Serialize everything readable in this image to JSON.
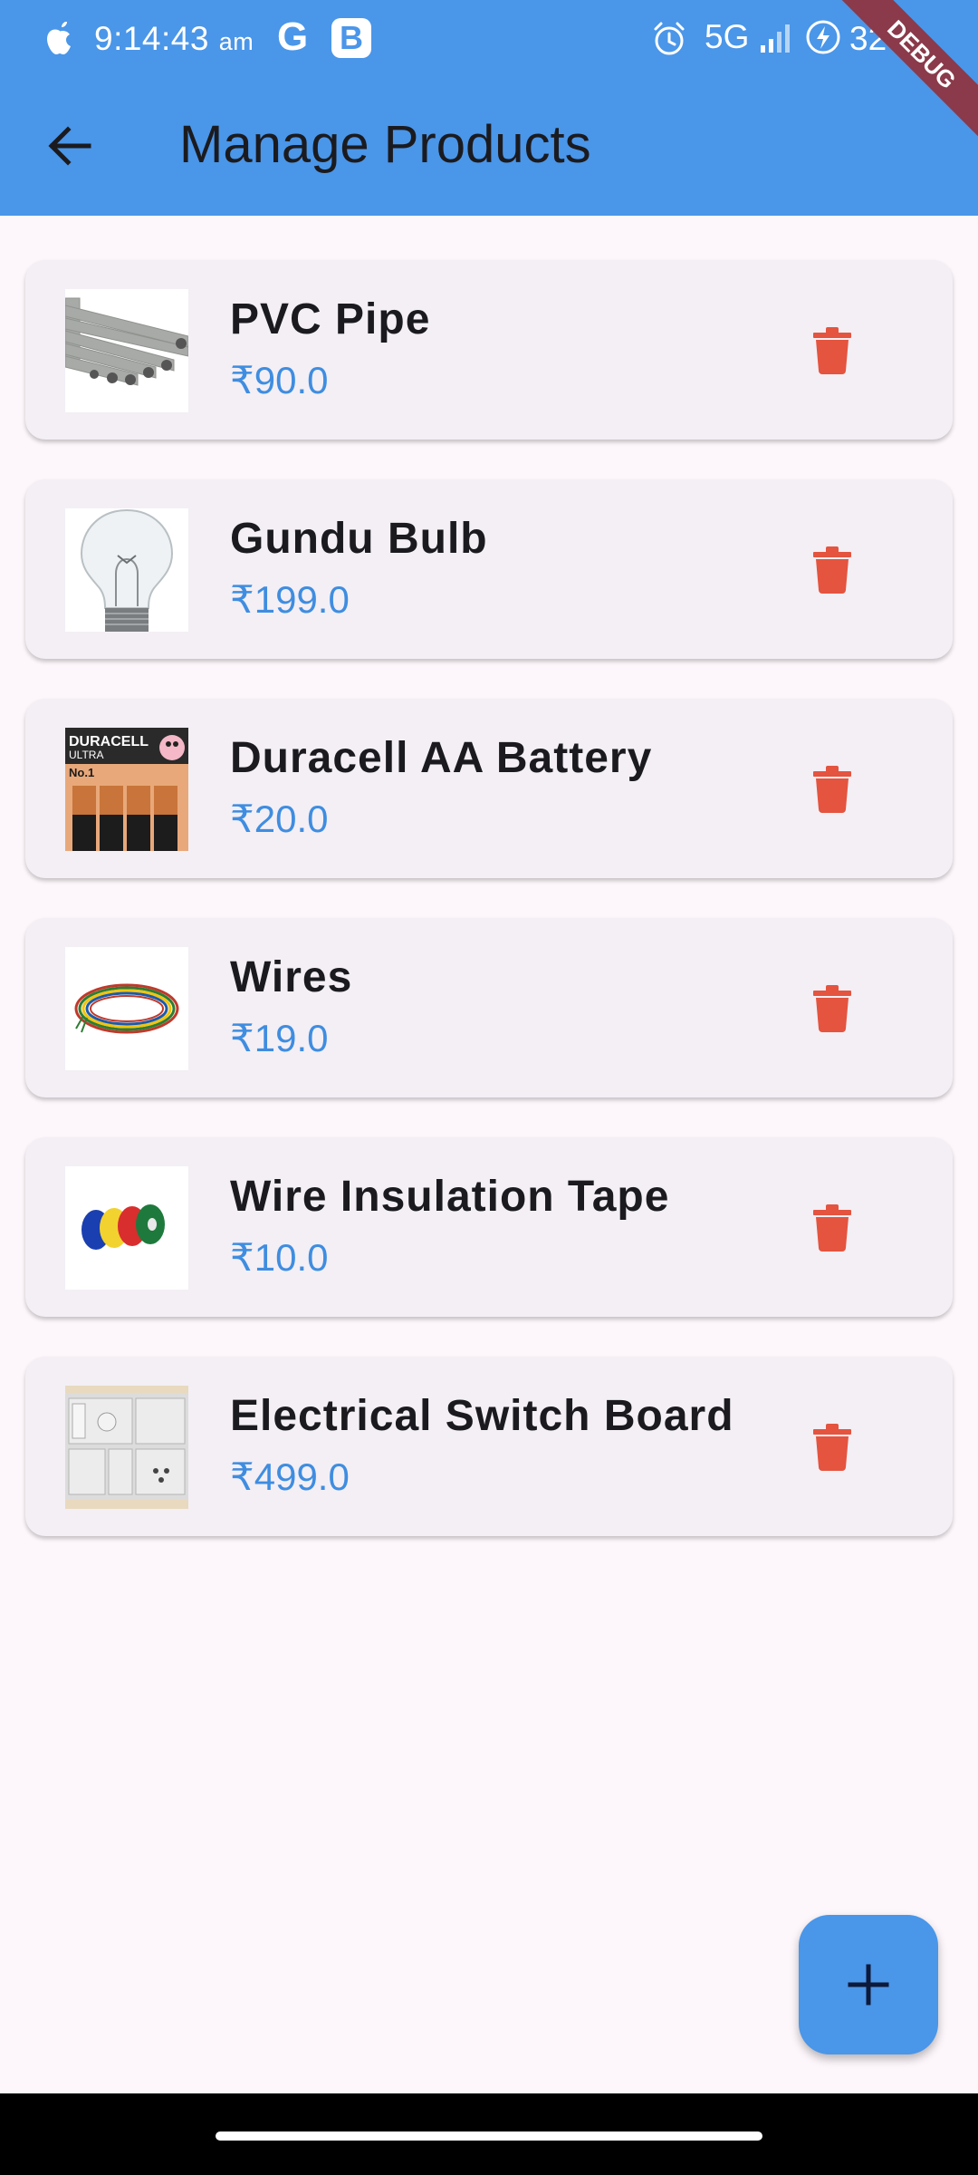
{
  "status_bar": {
    "time": "9:14:43",
    "ampm": "am",
    "network": "5G",
    "battery": "32"
  },
  "debug_label": "DEBUG",
  "header": {
    "title": "Manage Products"
  },
  "products": [
    {
      "name": "PVC Pipe",
      "price": "₹90.0"
    },
    {
      "name": "Gundu Bulb",
      "price": "₹199.0"
    },
    {
      "name": "Duracell AA Battery",
      "price": "₹20.0"
    },
    {
      "name": "Wires",
      "price": "₹19.0"
    },
    {
      "name": "Wire Insulation Tape",
      "price": "₹10.0"
    },
    {
      "name": "Electrical Switch Board",
      "price": "₹499.0"
    }
  ],
  "thumbnail_texts": {
    "battery_brand": "DURACELL",
    "battery_sub": "ULTRA",
    "battery_badge": "No.1"
  },
  "icons": {
    "back": "arrow-left-icon",
    "delete": "trash-icon",
    "add": "plus-icon"
  },
  "colors": {
    "app_bar": "#4a96e9",
    "price": "#3f8de0",
    "delete": "#e4543f",
    "background": "#fdf7fb",
    "card": "#f3eff5"
  }
}
